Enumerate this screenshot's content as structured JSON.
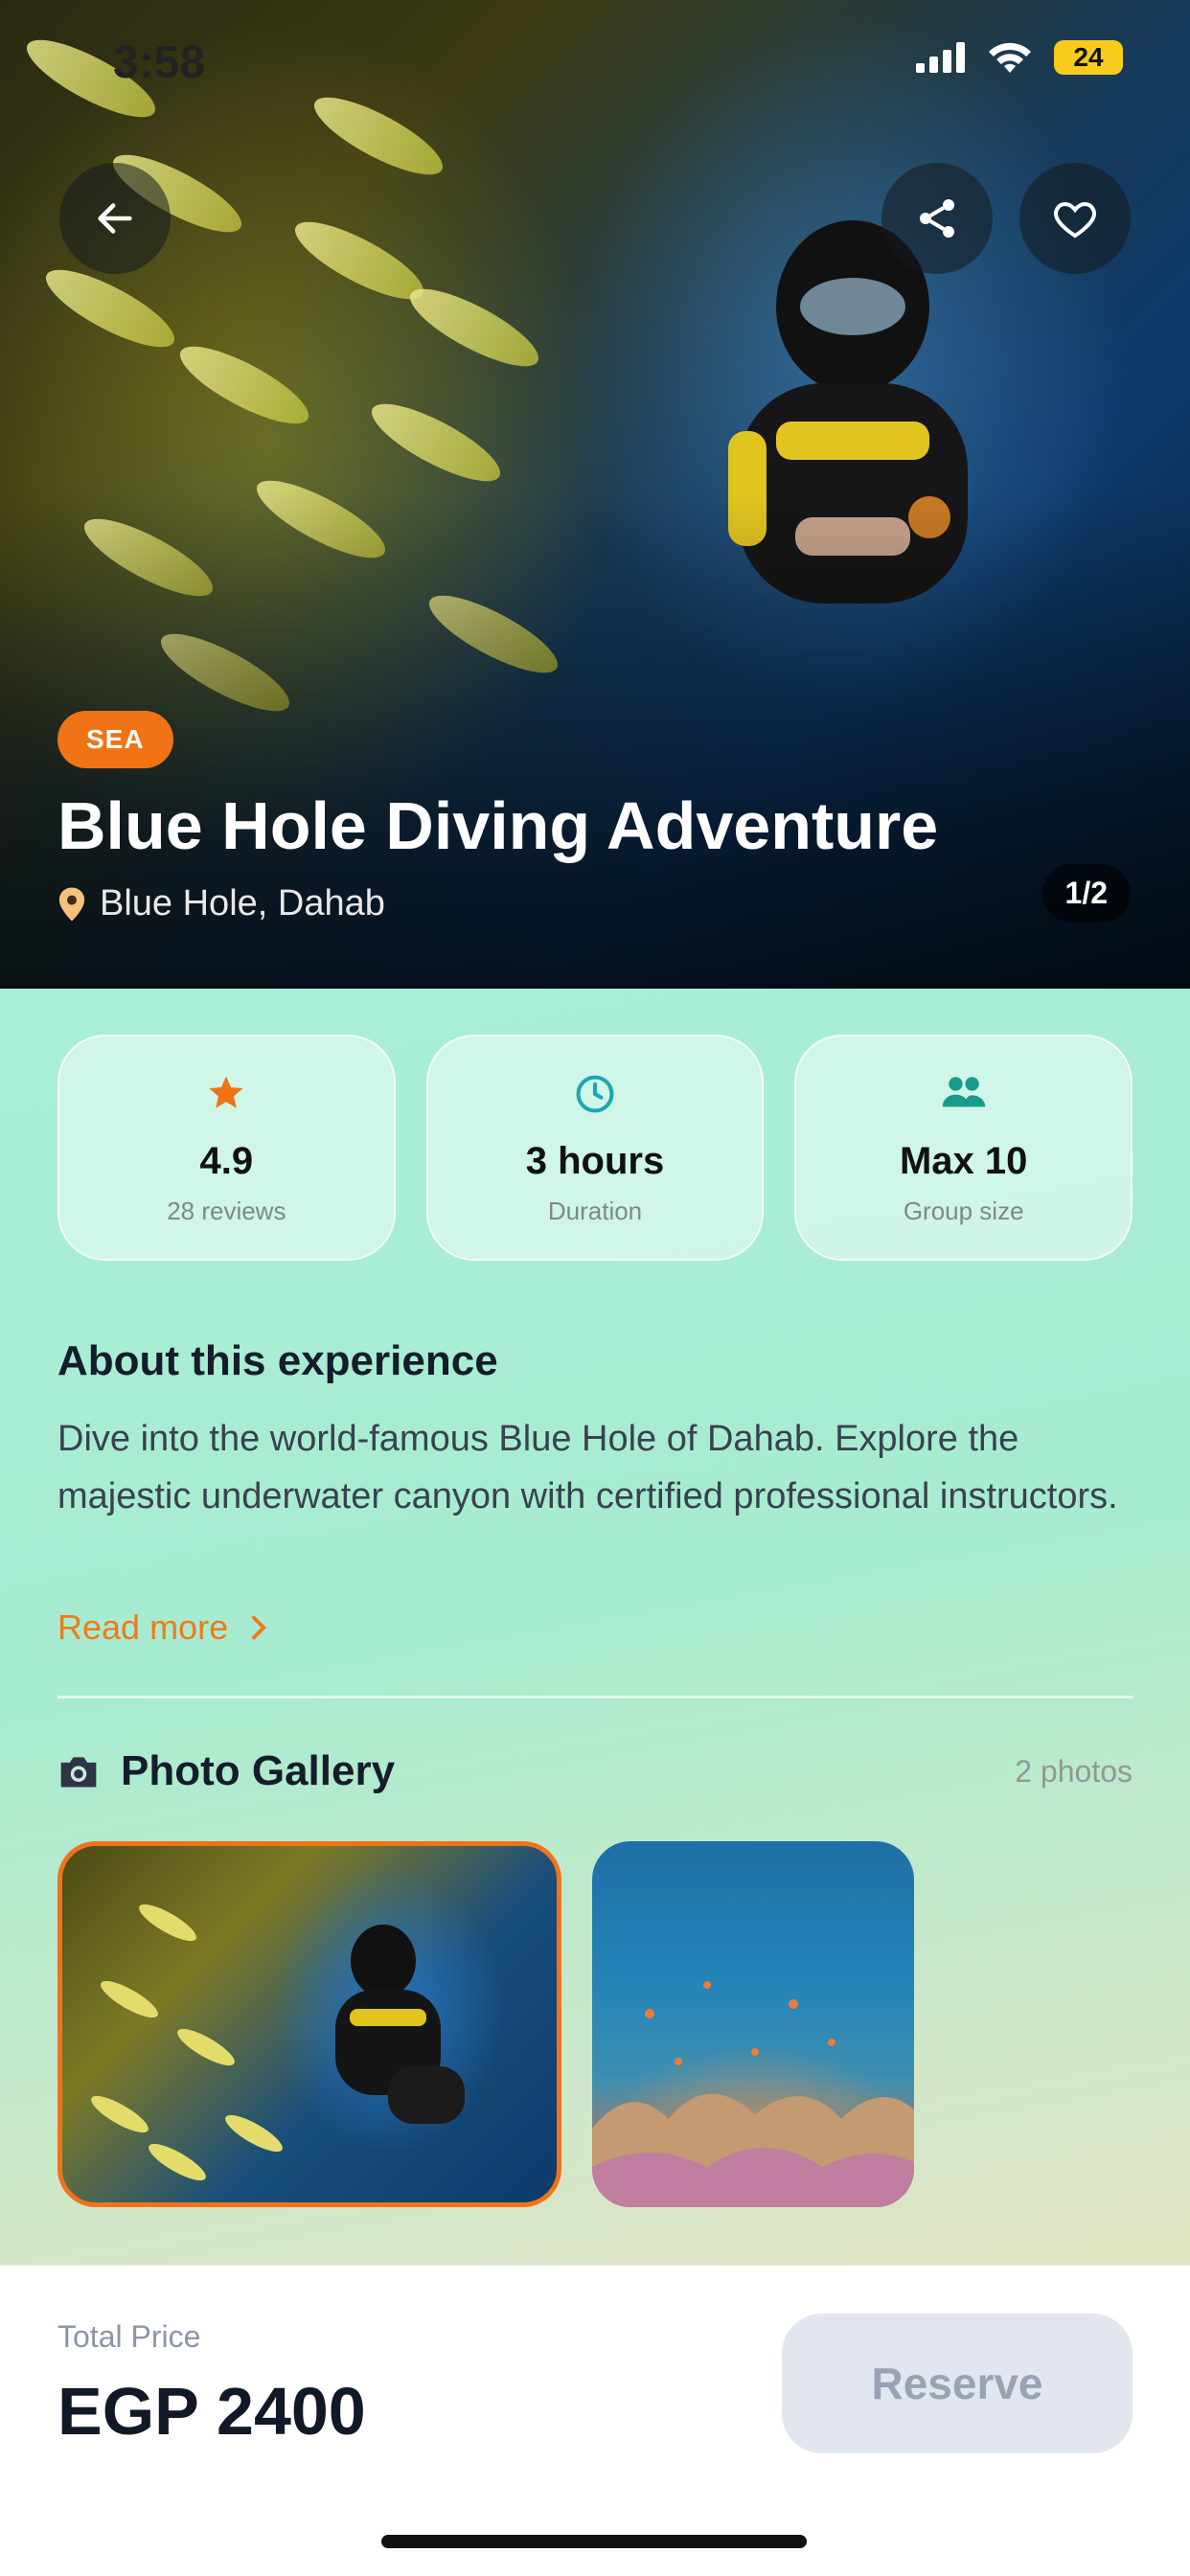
{
  "status_bar": {
    "time": "3:58",
    "battery": "24"
  },
  "hero": {
    "category_badge": "SEA",
    "title": "Blue Hole Diving Adventure",
    "location": "Blue Hole, Dahab",
    "image_counter": "1/2"
  },
  "stats": [
    {
      "icon": "star-icon",
      "value": "4.9",
      "label": "28 reviews"
    },
    {
      "icon": "clock-icon",
      "value": "3 hours",
      "label": "Duration"
    },
    {
      "icon": "group-icon",
      "value": "Max 10",
      "label": "Group size"
    }
  ],
  "about": {
    "title": "About this experience",
    "text": "Dive into the world-famous Blue Hole of Dahab. Explore the majestic underwater canyon with certified professional instructors.",
    "read_more": "Read more"
  },
  "gallery": {
    "title": "Photo Gallery",
    "count": "2 photos"
  },
  "booking": {
    "price_label": "Total Price",
    "price": "EGP 2400",
    "reserve_label": "Reserve"
  },
  "colors": {
    "accent": "#f07316",
    "teal": "#1aa7a7"
  }
}
